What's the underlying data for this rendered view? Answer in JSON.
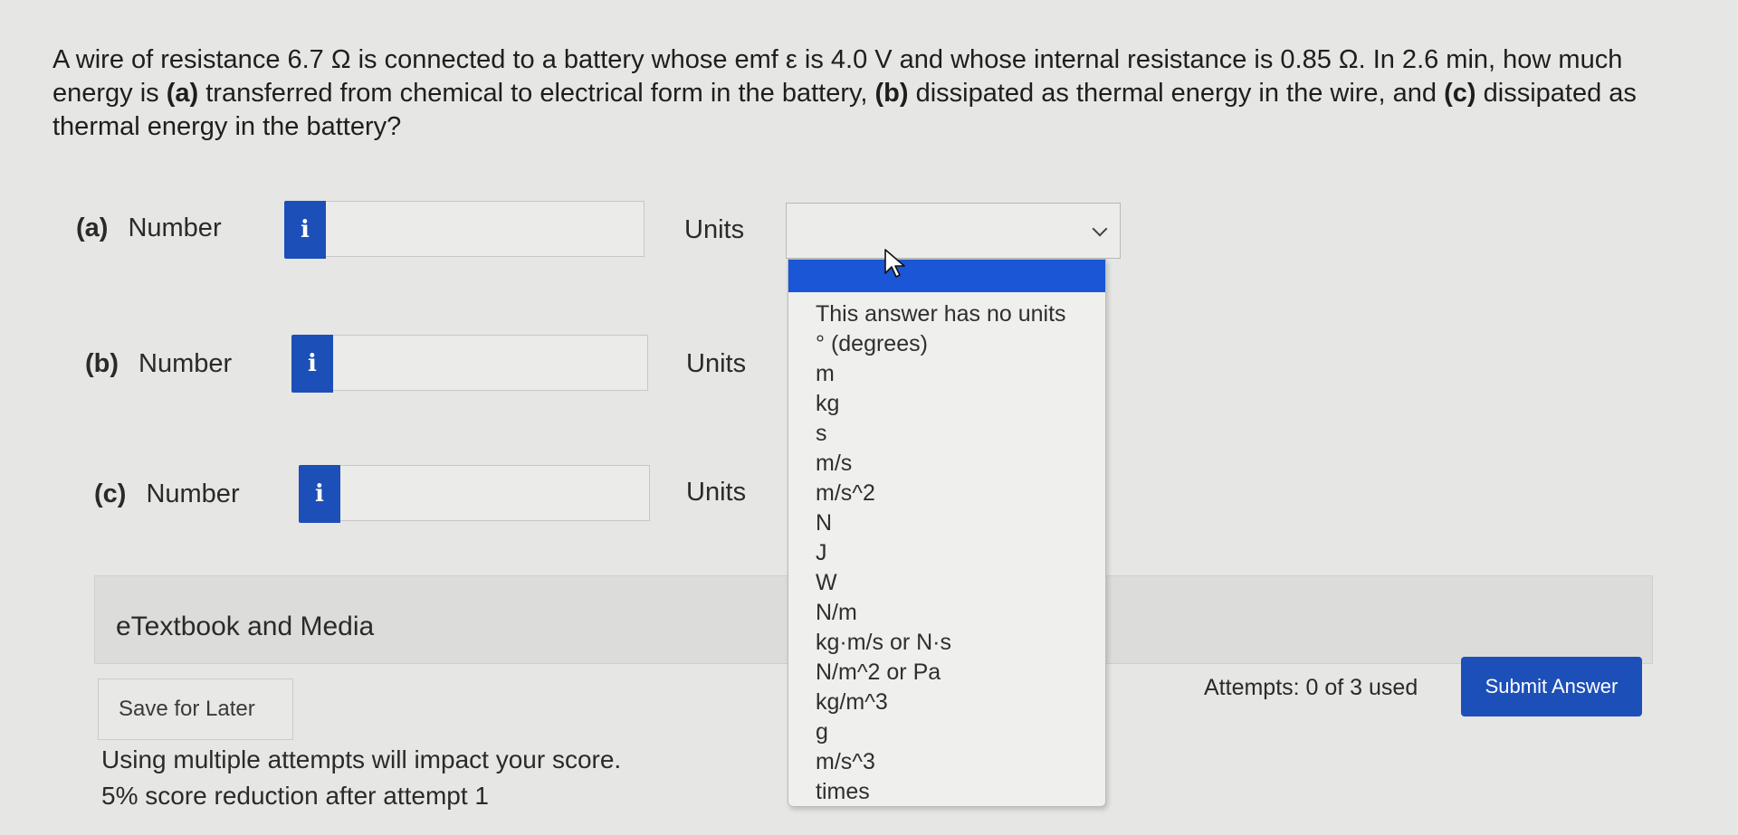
{
  "question": {
    "segments": [
      {
        "text": "A wire of resistance 6.7 Ω is connected to a battery whose emf ε is 4.0 V and whose internal resistance is 0.85 Ω. In 2.6 min, how much energy is ",
        "bold": false
      },
      {
        "text": "(a)",
        "bold": true
      },
      {
        "text": " transferred from chemical to electrical form in the battery, ",
        "bold": false
      },
      {
        "text": "(b)",
        "bold": true
      },
      {
        "text": " dissipated as thermal energy in the wire, and ",
        "bold": false
      },
      {
        "text": "(c)",
        "bold": true
      },
      {
        "text": " dissipated as thermal energy in the battery?",
        "bold": false
      }
    ]
  },
  "parts": [
    {
      "letter": "(a)",
      "number_label": "Number",
      "info_icon": "i",
      "value": "",
      "units_label": "Units"
    },
    {
      "letter": "(b)",
      "number_label": "Number",
      "info_icon": "i",
      "value": "",
      "units_label": "Units"
    },
    {
      "letter": "(c)",
      "number_label": "Number",
      "info_icon": "i",
      "value": "",
      "units_label": "Units"
    }
  ],
  "units_select": {
    "selected": "",
    "icon": "chevron-down-icon"
  },
  "units_options": [
    "This answer has no units",
    "° (degrees)",
    "m",
    "kg",
    "s",
    "m/s",
    "m/s^2",
    "N",
    "J",
    "W",
    "N/m",
    "kg·m/s or N·s",
    "N/m^2 or Pa",
    "kg/m^3",
    "g",
    "m/s^3",
    "times"
  ],
  "etextbook_label": "eTextbook and Media",
  "save_label": "Save for Later",
  "attempts_text": "Attempts: 0 of 3 used",
  "submit_label": "Submit Answer",
  "notes": [
    "Using multiple attempts will impact your score.",
    "5% score reduction after attempt 1"
  ],
  "colors": {
    "accent": "#1d4fb8",
    "highlight": "#1a56d6"
  }
}
